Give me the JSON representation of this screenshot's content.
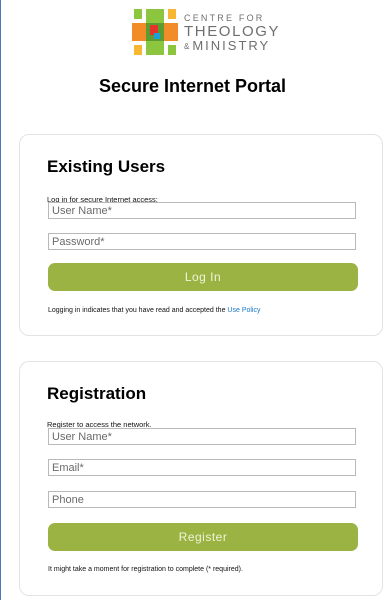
{
  "brand": {
    "line1": "CENTRE FOR",
    "line2": "THEOLOGY",
    "line3_amp": "&",
    "line3": "MINISTRY"
  },
  "page_title": "Secure Internet Portal",
  "login": {
    "heading": "Existing Users",
    "hint": "Log in for secure Internet access:",
    "username_placeholder": "User Name*",
    "password_placeholder": "Password*",
    "button_label": "Log In",
    "note_prefix": "Logging in indicates that you have read and accepted the ",
    "policy_link": "Use Policy"
  },
  "registration": {
    "heading": "Registration",
    "hint": "Register to access the network.",
    "username_placeholder": "User Name*",
    "email_placeholder": "Email*",
    "phone_placeholder": "Phone",
    "button_label": "Register",
    "note": "It might take a moment for registration to complete (* required)."
  },
  "colors": {
    "accent_green": "#9bb342",
    "link_blue": "#1a79c8",
    "logo_orange": "#f28c28",
    "logo_green": "#8cc63f",
    "logo_red": "#e4322b",
    "logo_blue": "#1d9fd9"
  }
}
